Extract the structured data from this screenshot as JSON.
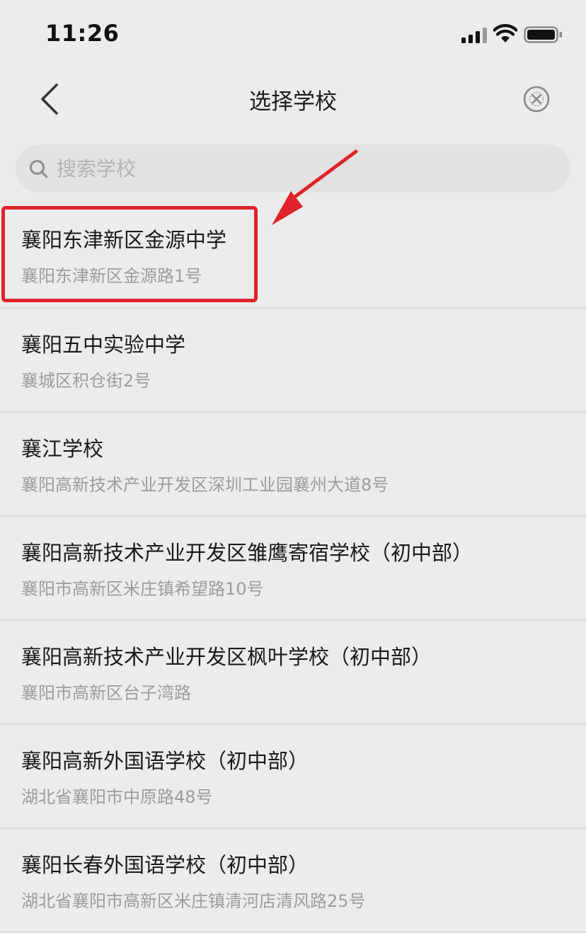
{
  "status_bar": {
    "time": "11:26"
  },
  "nav": {
    "title": "选择学校",
    "back_icon": "chevron-left-icon",
    "close_icon": "circle-close-icon"
  },
  "search": {
    "placeholder": "搜索学校",
    "value": ""
  },
  "schools": [
    {
      "name": "襄阳东津新区金源中学",
      "address": "襄阳东津新区金源路1号"
    },
    {
      "name": "襄阳五中实验中学",
      "address": "襄城区积仓街2号"
    },
    {
      "name": "襄江学校",
      "address": "襄阳高新技术产业开发区深圳工业园襄州大道8号"
    },
    {
      "name": "襄阳高新技术产业开发区雏鹰寄宿学校（初中部）",
      "address": "襄阳市高新区米庄镇希望路10号"
    },
    {
      "name": "襄阳高新技术产业开发区枫叶学校（初中部）",
      "address": "襄阳市高新区台子湾路"
    },
    {
      "name": "襄阳高新外国语学校（初中部）",
      "address": "湖北省襄阳市中原路48号"
    },
    {
      "name": "襄阳长春外国语学校（初中部）",
      "address": "湖北省襄阳市高新区米庄镇清河店清风路25号"
    }
  ],
  "annotation": {
    "color": "#e0232a"
  }
}
